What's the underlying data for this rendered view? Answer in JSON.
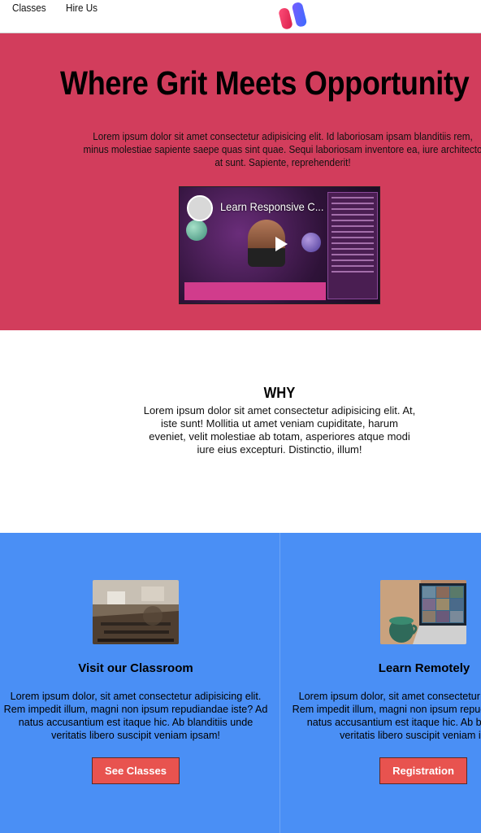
{
  "nav": {
    "links": [
      "Classes",
      "Hire Us"
    ]
  },
  "hero": {
    "title": "Where Grit Meets Opportunity",
    "lead": "Lorem ipsum dolor sit amet consectetur adipisicing elit. Id laboriosam ipsam blanditiis rem,\nminus molestiae sapiente saepe quas sint quae. Sequi laboriosam inventore ea, iure architecto\nat sunt. Sapiente, reprehenderit!",
    "video": {
      "title": "Learn Responsive C..."
    }
  },
  "why": {
    "title": "WHY",
    "text": "Lorem ipsum dolor sit amet consectetur adipisicing elit. At, iste sunt! Mollitia ut amet veniam cupiditate, harum eveniet, velit molestiae ab totam, asperiores atque modi iure eius excepturi. Distinctio, illum!"
  },
  "features": [
    {
      "title": "Visit our Classroom",
      "text": "Lorem ipsum dolor, sit amet consectetur adipisicing elit. Rem impedit illum, magni non ipsum repudiandae iste? Ad natus accusantium est itaque hic. Ab blanditiis unde veritatis libero suscipit veniam ipsam!",
      "button": "See Classes"
    },
    {
      "title": "Learn Remotely",
      "text": "Lorem ipsum dolor, sit amet consectetur adipisicing elit. Rem impedit illum, magni non ipsum repudiandae iste? Ad natus accusantium est itaque hic. Ab blanditiis unde veritatis libero suscipit veniam ipsam!",
      "button": "Registration"
    }
  ],
  "colors": {
    "hero_bg": "#d23d5c",
    "features_bg": "#4a8ff5",
    "button_bg": "#e8534f"
  }
}
